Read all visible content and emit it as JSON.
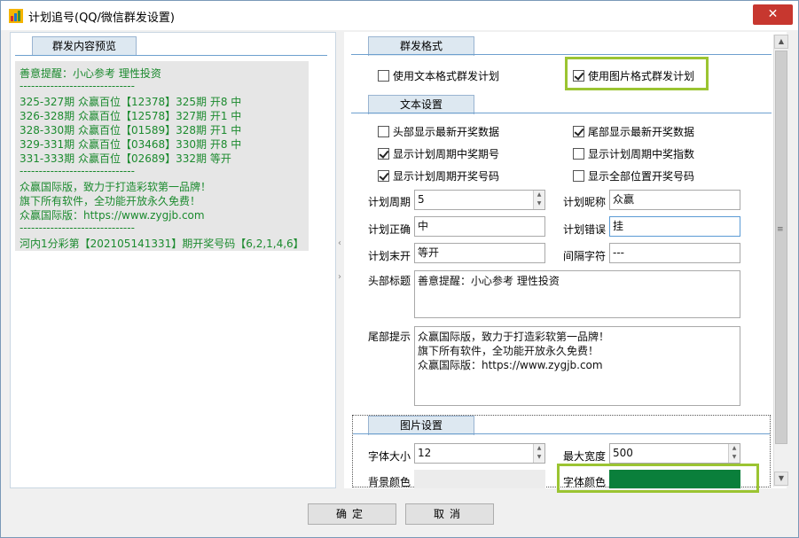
{
  "window": {
    "title": "计划追号(QQ/微信群发设置)",
    "close_symbol": "✕"
  },
  "left": {
    "tab_label": "群发内容预览",
    "preview_lines": [
      "善意提醒：小心参考    理性投资",
      "------------------------------",
      "325-327期 众赢百位【12378】325期 开8 中",
      "326-328期 众赢百位【12578】327期 开1 中",
      "328-330期 众赢百位【01589】328期 开1 中",
      "329-331期 众赢百位【03468】330期 开8 中",
      "331-333期 众赢百位【02689】332期 等开",
      "------------------------------",
      "众赢国际版，致力于打造彩软第一品牌！",
      "旗下所有软件，全功能开放永久免费！",
      "众赢国际版：https://www.zygjb.com",
      "------------------------------",
      "河内1分彩第【202105141331】期开奖号码【6,2,1,4,6】"
    ]
  },
  "sections": {
    "format": {
      "tab_label": "群发格式",
      "text_mode": {
        "label": "使用文本格式群发计划",
        "checked": false
      },
      "image_mode": {
        "label": "使用图片格式群发计划",
        "checked": true
      }
    },
    "text": {
      "tab_label": "文本设置",
      "options": [
        {
          "label": "头部显示最新开奖数据",
          "checked": false
        },
        {
          "label": "尾部显示最新开奖数据",
          "checked": true
        },
        {
          "label": "显示计划周期中奖期号",
          "checked": true
        },
        {
          "label": "显示计划周期中奖指数",
          "checked": false
        },
        {
          "label": "显示计划周期开奖号码",
          "checked": true
        },
        {
          "label": "显示全部位置开奖号码",
          "checked": false
        }
      ],
      "fields": {
        "cycle": {
          "label": "计划周期",
          "value": "5"
        },
        "nickname": {
          "label": "计划昵称",
          "value": "众赢"
        },
        "correct": {
          "label": "计划正确",
          "value": "中"
        },
        "wrong": {
          "label": "计划错误",
          "value": "挂"
        },
        "pending": {
          "label": "计划末开",
          "value": "等开"
        },
        "separator": {
          "label": "间隔字符",
          "value": "---"
        }
      },
      "header": {
        "label": "头部标题",
        "lines": [
          "善意提醒：小心参考    理性投资"
        ]
      },
      "footer": {
        "label": "尾部提示",
        "lines": [
          "众赢国际版，致力于打造彩软第一品牌！",
          "旗下所有软件，全功能开放永久免费！",
          "众赢国际版：https://www.zygjb.com"
        ]
      }
    },
    "image": {
      "tab_label": "图片设置",
      "font_size": {
        "label": "字体大小",
        "value": "12"
      },
      "max_width": {
        "label": "最大宽度",
        "value": "500"
      },
      "bg_color": {
        "label": "背景颜色",
        "color": "#ececec"
      },
      "font_color": {
        "label": "字体颜色",
        "color": "#0a7f3b"
      }
    }
  },
  "buttons": {
    "ok": "确定",
    "cancel": "取消"
  },
  "colors": {
    "preview_text": "#1b8a2e",
    "highlight": "#9bc432",
    "close": "#c7372f"
  }
}
